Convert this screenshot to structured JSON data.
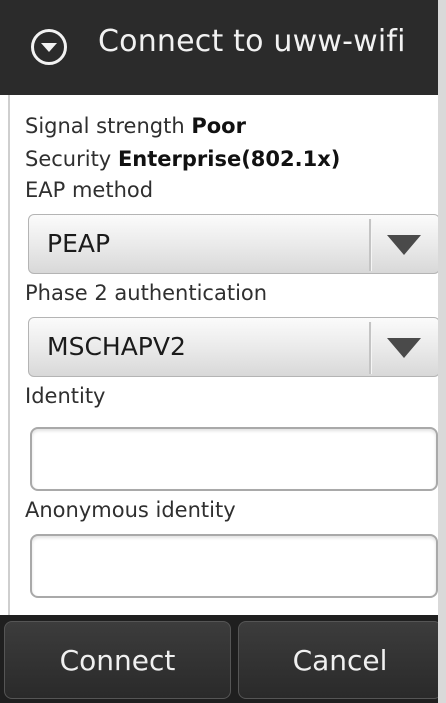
{
  "title": "Connect to uww-wifi",
  "info": {
    "signal_label": "Signal strength",
    "signal_value": "Poor",
    "security_label": "Security",
    "security_value": "Enterprise(802.1x)"
  },
  "eap": {
    "label": "EAP method",
    "value": "PEAP"
  },
  "phase2": {
    "label": "Phase 2 authentication",
    "value": "MSCHAPV2"
  },
  "identity": {
    "label": "Identity",
    "value": ""
  },
  "anonymous": {
    "label": "Anonymous identity",
    "value": ""
  },
  "buttons": {
    "connect": "Connect",
    "cancel": "Cancel"
  },
  "icons": {
    "title_icon": "chevron-down-circle-icon",
    "dropdown_icon": "dropdown-arrow-icon"
  }
}
